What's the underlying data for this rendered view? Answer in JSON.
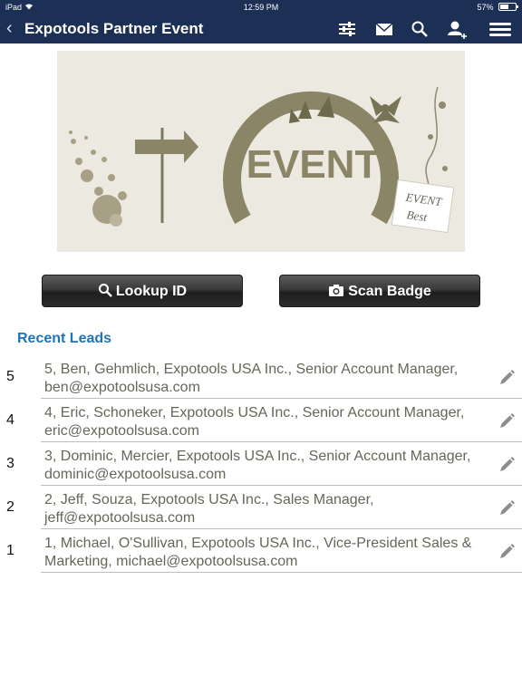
{
  "status_bar": {
    "device": "iPad",
    "time": "12:59 PM",
    "battery_text": "57%",
    "battery_level": 0.57
  },
  "nav": {
    "title": "Expotools Partner Event",
    "icons": [
      "back-icon",
      "filter-sliders-icon",
      "mail-icon",
      "search-icon",
      "add-user-icon",
      "menu-icon"
    ]
  },
  "banner": {
    "event_text": "EVENT",
    "card_line1": "EVENT",
    "card_line2": "Best"
  },
  "actions": {
    "lookup_label": "Lookup ID",
    "scan_label": "Scan Badge"
  },
  "recent_leads": {
    "title": "Recent Leads",
    "items": [
      {
        "number": "5",
        "text": "5, Ben, Gehmlich, Expotools USA Inc., Senior Account Manager, ben@expotoolsusa.com"
      },
      {
        "number": "4",
        "text": "4, Eric, Schoneker, Expotools USA Inc., Senior Account Manager, eric@expotoolsusa.com"
      },
      {
        "number": "3",
        "text": "3, Dominic, Mercier, Expotools USA Inc., Senior Account Manager, dominic@expotoolsusa.com"
      },
      {
        "number": "2",
        "text": "2, Jeff, Souza, Expotools USA Inc., Sales Manager, jeff@expotoolsusa.com"
      },
      {
        "number": "1",
        "text": "1, Michael, O'Sullivan, Expotools USA Inc., Vice-President Sales & Marketing, michael@expotoolsusa.com"
      }
    ]
  },
  "colors": {
    "nav_background": "#1c2f55",
    "section_title": "#1e73b8",
    "lead_text": "#666659",
    "banner_olive": "#8a8566"
  }
}
